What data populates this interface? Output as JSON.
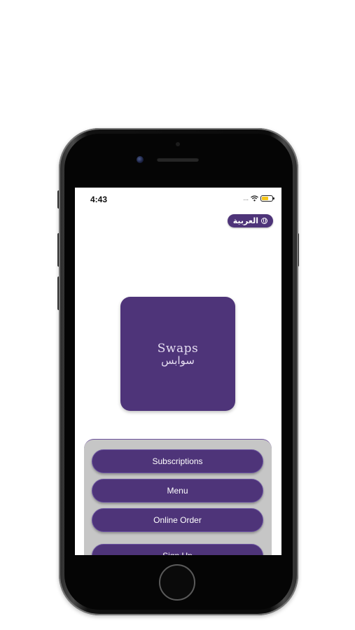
{
  "status_bar": {
    "time": "4:43",
    "signal": "...",
    "icons": [
      "wifi-icon",
      "battery-charging-icon"
    ]
  },
  "language_button": {
    "label": "العربية",
    "icon": "globe-icon"
  },
  "logo": {
    "text_en": "Swaps",
    "text_ar": "سوابس"
  },
  "actions": [
    {
      "label": "Subscriptions"
    },
    {
      "label": "Menu"
    },
    {
      "label": "Online Order"
    },
    {
      "label": "Sign Up"
    }
  ],
  "colors": {
    "brand_purple": "#4e3479",
    "panel_gray": "#c6c6c6",
    "phone_frame": "#0b0b0b",
    "battery_charge": "#f5c518"
  }
}
